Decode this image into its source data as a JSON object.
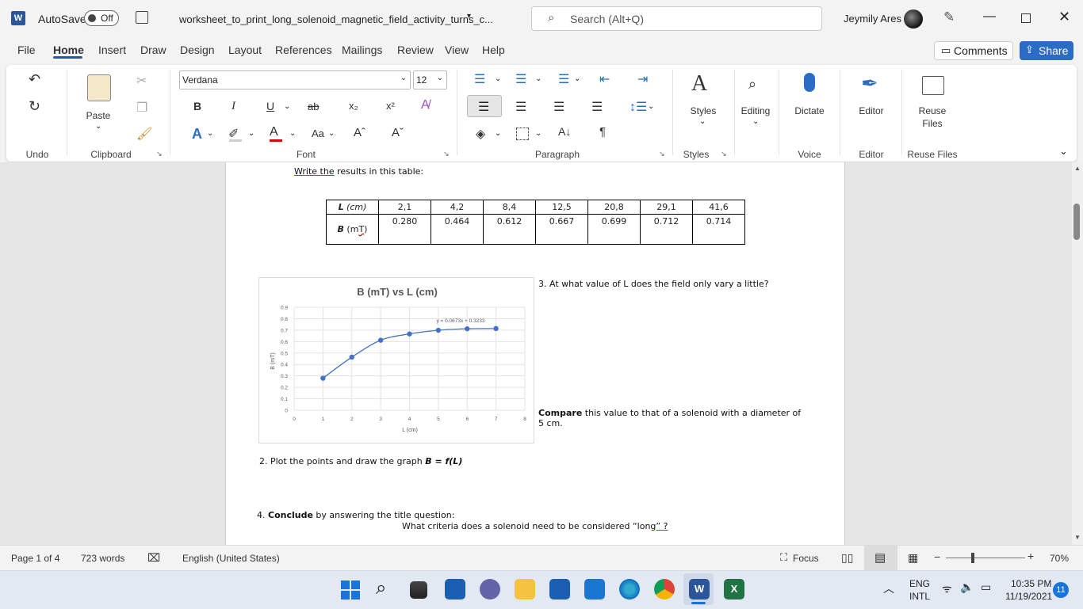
{
  "titlebar": {
    "autosave_label": "AutoSave",
    "autosave_state": "Off",
    "doc_title": "worksheet_to_print_long_solenoid_magnetic_field_activity_turns_c...",
    "search_placeholder": "Search (Alt+Q)",
    "user_name": "Jeymily Ares"
  },
  "tabs": [
    "File",
    "Home",
    "Insert",
    "Draw",
    "Design",
    "Layout",
    "References",
    "Mailings",
    "Review",
    "View",
    "Help"
  ],
  "active_tab": "Home",
  "comments_label": "Comments",
  "share_label": "Share",
  "ribbon": {
    "undo_group": "Undo",
    "paste_label": "Paste",
    "clipboard_group": "Clipboard",
    "font_name": "Verdana",
    "font_size": "12",
    "font_group": "Font",
    "paragraph_group": "Paragraph",
    "styles_label": "Styles",
    "styles_group": "Styles",
    "editing_label": "Editing",
    "dictate_label": "Dictate",
    "voice_group": "Voice",
    "editor_label": "Editor",
    "editor_group": "Editor",
    "reuse_label_1": "Reuse",
    "reuse_label_2": "Files",
    "reuse_group": "Reuse Files",
    "bold": "B",
    "italic": "I",
    "underline": "U",
    "strike": "ab",
    "subscript": "x₂",
    "superscript": "x²",
    "font_grow_label": "Aa",
    "pilcrow": "¶"
  },
  "document": {
    "instruction_underlined": "Write  the",
    "instruction_rest": " results in this table:",
    "table_L_label": "L (cm)",
    "table_B_label": "B (mT)",
    "L_values": [
      "2,1",
      "4,2",
      "8,4",
      "12,5",
      "20,8",
      "29,1",
      "41,6"
    ],
    "B_values": [
      "0.280",
      "0.464",
      "0.612",
      "0.667",
      "0.699",
      "0.712",
      "0.714"
    ],
    "q3": "3. At what value of L does the field only vary a little?",
    "compare_bold": "Compare",
    "compare_rest": " this value to that of a solenoid with a diameter of",
    "compare_line2": "5 cm.",
    "q2_prefix": "2. Plot the points and draw the graph ",
    "q2_formula": "B = f(L)",
    "q4_prefix": "4. ",
    "q4_bold": "Conclude",
    "q4_rest": " by answering the title question:",
    "q4_line2_text": "What criteria does a solenoid need to be considered “long",
    "q4_line2_underlined": "” ?"
  },
  "chart_data": {
    "type": "line",
    "title": "B (mT) vs L (cm)",
    "xlabel": "L (cm)",
    "ylabel": "B (mT)",
    "x": [
      1,
      2,
      3,
      4,
      5,
      6,
      7
    ],
    "y": [
      0.28,
      0.464,
      0.612,
      0.667,
      0.699,
      0.712,
      0.714
    ],
    "xlim": [
      0,
      8
    ],
    "ylim": [
      0,
      0.9
    ],
    "xticks": [
      "0",
      "1",
      "2",
      "3",
      "4",
      "5",
      "6",
      "7",
      "8"
    ],
    "yticks": [
      "0",
      "0.1",
      "0.2",
      "0.3",
      "0.4",
      "0.5",
      "0.6",
      "0.7",
      "0.8",
      "0.9"
    ],
    "trendline_label": "y = 0.0673x + 0.3233",
    "grid": true,
    "color": "#4472c4"
  },
  "status": {
    "page": "Page 1 of 4",
    "words": "723 words",
    "language": "English (United States)",
    "focus": "Focus",
    "zoom": "70%"
  },
  "taskbar": {
    "lang1": "ENG",
    "lang2": "INTL",
    "time": "10:35 PM",
    "date": "11/19/2021",
    "notifications": "11"
  }
}
